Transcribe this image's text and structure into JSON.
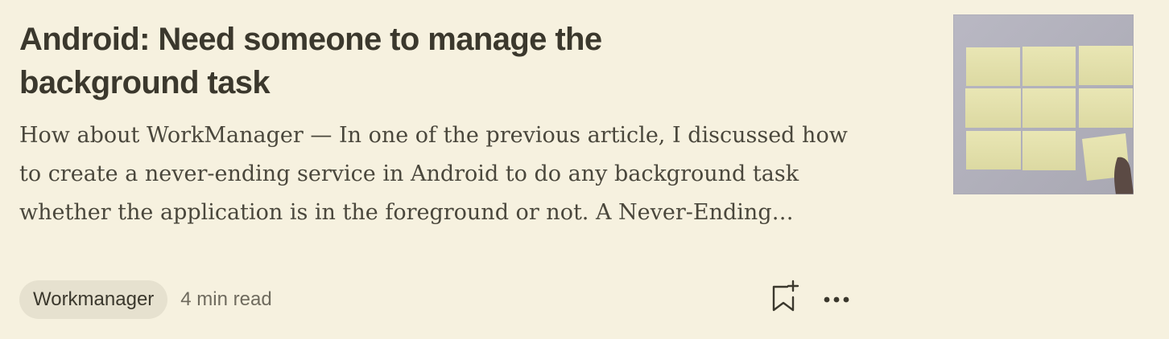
{
  "article": {
    "title": "Android: Need someone to manage the background task",
    "excerpt": "How about WorkManager — In one of the previous article, I discussed how to create a never-ending service in Android to do any background task whether the application is in the foreground or not. A Never-Ending…",
    "tag": "Workmanager",
    "read_time": "4 min read"
  },
  "icons": {
    "bookmark": "bookmark-add-icon",
    "more": "more-horizontal-icon"
  },
  "thumbnail": {
    "description_icon": "sticky-notes-image"
  },
  "colors": {
    "background": "#f6f1df",
    "title": "#3b382d",
    "body": "#4a473c",
    "tag_bg": "#e6e1cf",
    "muted": "#6f6b5e"
  }
}
